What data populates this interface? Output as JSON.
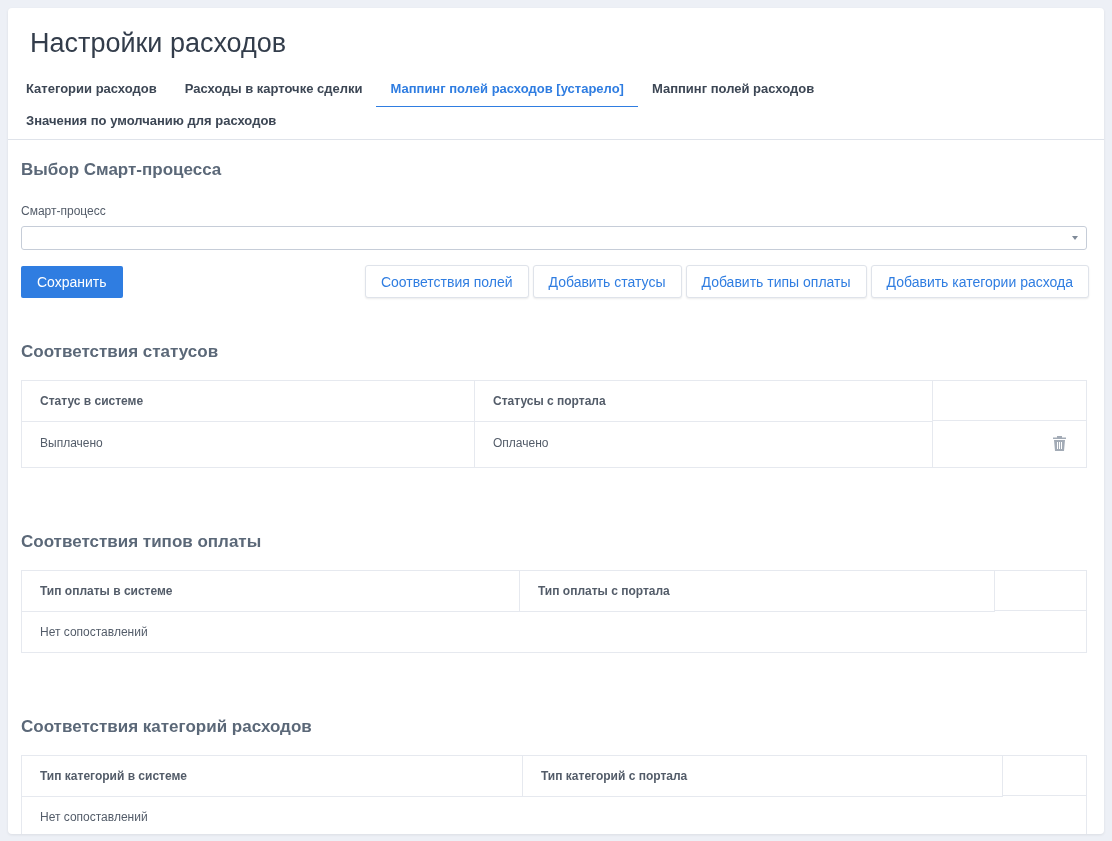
{
  "page": {
    "title": "Настройки расходов"
  },
  "tabs": [
    {
      "label": "Категории расходов",
      "selected": false
    },
    {
      "label": "Расходы в карточке сделки",
      "selected": false
    },
    {
      "label": "Маппинг полей расходов [устарело]",
      "selected": true
    },
    {
      "label": "Маппинг полей расходов",
      "selected": false
    },
    {
      "label": "Значения по умолчанию для расходов",
      "selected": false
    }
  ],
  "smart_process": {
    "title": "Выбор Смарт-процесса",
    "label": "Смарт-процесс"
  },
  "save_button": "Сохранить",
  "action_buttons": [
    "Соответствия полей",
    "Добавить статусы",
    "Добавить типы оплаты",
    "Добавить категории расхода"
  ],
  "sections": [
    {
      "title": "Соответствия статусов",
      "columns": [
        "Статус в системе",
        "Статусы с портала"
      ],
      "rows": [
        [
          "Выплачено",
          "Оплачено"
        ]
      ]
    },
    {
      "title": "Соответствия типов оплаты",
      "columns": [
        "Тип оплаты в системе",
        "Тип оплаты с портала"
      ],
      "empty_text": "Нет сопоставлений"
    },
    {
      "title": "Соответствия категорий расходов",
      "columns": [
        "Тип категорий в системе",
        "Тип категорий с портала"
      ],
      "empty_text": "Нет сопоставлений"
    }
  ]
}
